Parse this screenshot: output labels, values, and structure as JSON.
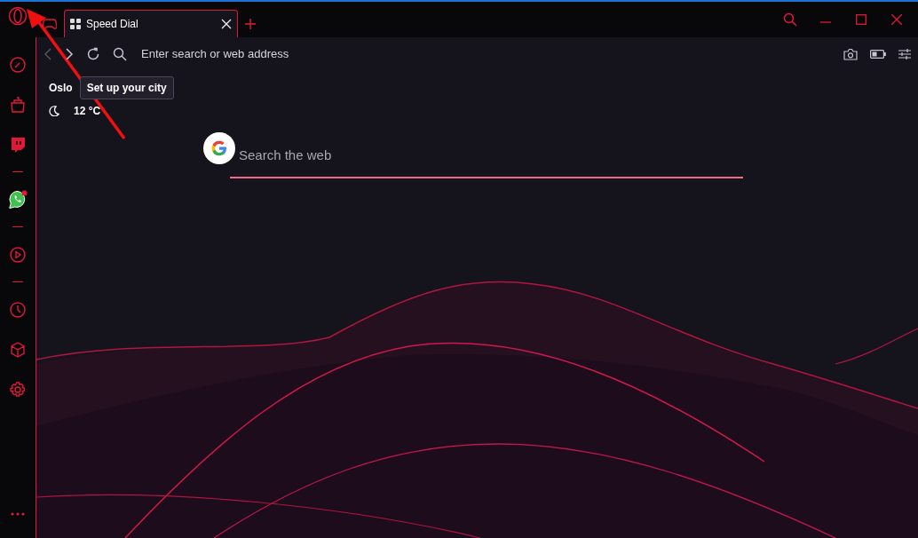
{
  "tabs": [
    {
      "kind": "game",
      "selected": false
    },
    {
      "kind": "page",
      "label": "Speed Dial",
      "selected": true
    }
  ],
  "address_bar": {
    "placeholder": "Enter search or web address"
  },
  "sidebar": {
    "items": [
      {
        "kind": "speed"
      },
      {
        "kind": "bag"
      },
      {
        "kind": "twitch"
      },
      {
        "kind": "divider"
      },
      {
        "kind": "whatsapp",
        "notification": true
      },
      {
        "kind": "divider"
      },
      {
        "kind": "player"
      },
      {
        "kind": "divider"
      },
      {
        "kind": "clock"
      },
      {
        "kind": "cube"
      },
      {
        "kind": "gear"
      }
    ]
  },
  "weather": {
    "city": "Oslo",
    "tooltip": "Set up your city",
    "temperature": "12 °C"
  },
  "search": {
    "placeholder": "Search the web"
  }
}
